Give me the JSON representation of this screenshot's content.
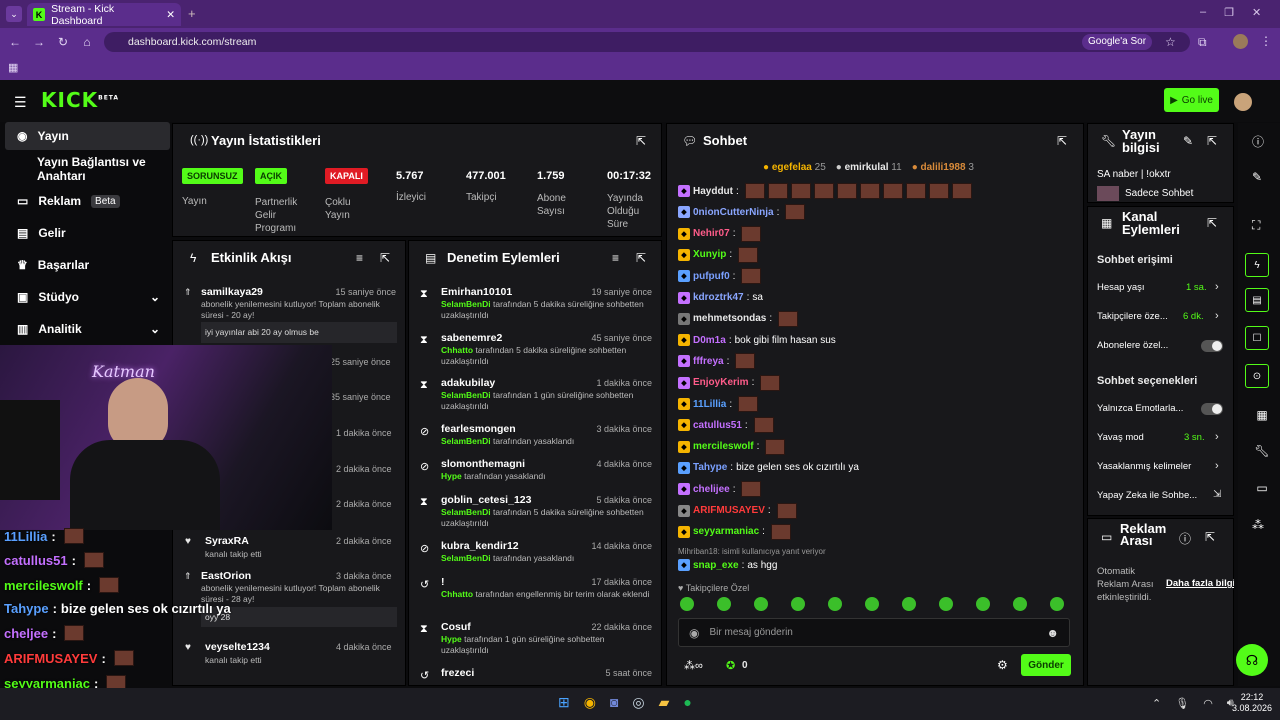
{
  "browser": {
    "tab_title": "Stream - Kick Dashboard",
    "url": "dashboard.kick.com/stream",
    "google_btn": "Google'a Sor"
  },
  "app": {
    "logo": "KICK",
    "logo_badge": "BETA",
    "go_live": "Go live"
  },
  "nav": [
    {
      "label": "Yayın"
    },
    {
      "label": "Yayın Bağlantısı ve Anahtarı"
    },
    {
      "label": "Reklam",
      "badge": "Beta"
    },
    {
      "label": "Gelir"
    },
    {
      "label": "Başarılar"
    },
    {
      "label": "Stüdyo"
    },
    {
      "label": "Analitik"
    }
  ],
  "stats": {
    "title": "Yayın İstatistikleri",
    "items": [
      {
        "badge": "SORUNSUZ",
        "label": "Yayın"
      },
      {
        "badge": "AÇIK",
        "label": "Partnerlik Gelir Programı"
      },
      {
        "badge": "KAPALI",
        "label": "Çoklu Yayın"
      },
      {
        "value": "5.767",
        "label": "İzleyici"
      },
      {
        "value": "477.001",
        "label": "Takipçi"
      },
      {
        "value": "1.759",
        "label": "Abone Sayısı"
      },
      {
        "value": "00:17:32",
        "label": "Yayında Olduğu Süre"
      }
    ]
  },
  "activity": {
    "title": "Etkinlik Akışı",
    "events": [
      {
        "name": "samilkaya29",
        "time": "15 saniye önce",
        "desc": "abonelik yenilemesini kutluyor! Toplam abonelik süresi - 20 ay!",
        "msg": "iyi yayınlar abi 20 ay olmus be"
      },
      {
        "time": "25 saniye önce"
      },
      {
        "time": "35 saniye önce"
      },
      {
        "time": "1 dakika önce"
      },
      {
        "time": "2 dakika önce"
      },
      {
        "time": "2 dakika önce"
      },
      {
        "name": "SyraxRA",
        "time": "2 dakika önce",
        "desc": "kanalı takip etti"
      },
      {
        "name": "EastOrion",
        "time": "3 dakika önce",
        "desc": "abonelik yenilemesini kutluyor! Toplam abonelik süresi - 28 ay!",
        "msg": "oyy 28"
      },
      {
        "name": "veyselte1234",
        "time": "4 dakika önce",
        "desc": "kanalı takip etti"
      }
    ]
  },
  "mod": {
    "title": "Denetim Eylemleri",
    "actions": [
      {
        "name": "Emirhan10101",
        "time": "19 saniye önce",
        "actor": "SelamBenDi",
        "desc": "tarafından 5 dakika süreliğine sohbetten uzaklaştırıldı"
      },
      {
        "name": "sabenemre2",
        "time": "45 saniye önce",
        "actor": "Chhatto",
        "desc": "tarafından 5 dakika süreliğine sohbetten uzaklaştırıldı"
      },
      {
        "name": "adakubilay",
        "time": "1 dakika önce",
        "actor": "SelamBenDi",
        "desc": "tarafından 1 gün süreliğine sohbetten uzaklaştırıldı"
      },
      {
        "name": "fearlesmongen",
        "time": "3 dakika önce",
        "actor": "SelamBenDi",
        "desc": "tarafından yasaklandı"
      },
      {
        "name": "slomonthemagni",
        "time": "4 dakika önce",
        "actor": "Hype",
        "desc": "tarafından yasaklandı"
      },
      {
        "name": "goblin_cetesi_123",
        "time": "5 dakika önce",
        "actor": "SelamBenDi",
        "desc": "tarafından 5 dakika süreliğine sohbetten uzaklaştırıldı"
      },
      {
        "name": "kubra_kendir12",
        "time": "14 dakika önce",
        "actor": "SelamBenDi",
        "desc": "tarafından yasaklandı"
      },
      {
        "name": "!",
        "time": "17 dakika önce",
        "actor": "Chhatto",
        "desc": "tarafından engellenmiş bir terim olarak eklendi"
      },
      {
        "name": "Cosuf",
        "time": "22 dakika önce",
        "actor": "Hype",
        "desc": "tarafından 1 gün süreliğine sohbetten uzaklaştırıldı"
      },
      {
        "name": "frezeci",
        "time": "5 saat önce"
      }
    ]
  },
  "chat": {
    "title": "Sohbet",
    "top": [
      {
        "name": "egefelaa",
        "n": "25"
      },
      {
        "name": "emirkulal",
        "n": "11"
      },
      {
        "name": "dalili1988",
        "n": "3"
      }
    ],
    "lines": [
      {
        "user": "Hayddut",
        "color": "#e8e8e8",
        "text": ""
      },
      {
        "user": "0nionCutterNinja",
        "color": "#8aa6ff",
        "text": ""
      },
      {
        "user": "Nehir07",
        "color": "#ff5c8a",
        "text": ""
      },
      {
        "user": "Xunyip",
        "color": "#53fc18",
        "text": ""
      },
      {
        "user": "pufpuf0",
        "color": "#7aa0ff",
        "text": ""
      },
      {
        "user": "kdroztrk47",
        "color": "#8aa6ff",
        "text": "sa"
      },
      {
        "user": "mehmetsondas",
        "color": "#e8e8e8",
        "text": ""
      },
      {
        "user": "D0m1a",
        "color": "#c470ff",
        "text": "bok gibi film hasan sus"
      },
      {
        "user": "fffreya",
        "color": "#c470ff",
        "text": ""
      },
      {
        "user": "EnjoyKerim",
        "color": "#ff5c8a",
        "text": ""
      },
      {
        "user": "11Lillia",
        "color": "#5aa0ff",
        "text": ""
      },
      {
        "user": "catullus51",
        "color": "#c470ff",
        "text": ""
      },
      {
        "user": "mercileswolf",
        "color": "#53fc18",
        "text": ""
      },
      {
        "user": "Tahype",
        "color": "#7aa0ff",
        "text": "bize gelen ses ok cızırtılı ya"
      },
      {
        "user": "chelijee",
        "color": "#c470ff",
        "text": ""
      },
      {
        "user": "ARIFMUSAYEV",
        "color": "#ff3b3b",
        "text": ""
      },
      {
        "user": "seyyarmaniac",
        "color": "#53fc18",
        "text": ""
      }
    ],
    "reply": "Mihriban18: isimli kullanıcıya yanıt veriyor",
    "last_user": "snap_exe",
    "last_text": "as hgg",
    "followers_label": "Takipçilere Özel",
    "input_placeholder": "Bir mesaj gönderin",
    "count": "0",
    "send": "Gönder"
  },
  "info": {
    "title": "Yayın bilgisi",
    "stream_title": "SA naber | !okxtr",
    "chat_mode": "Sadece Sohbet"
  },
  "channel": {
    "title": "Kanal Eylemleri",
    "access": "Sohbet erişimi",
    "rows": [
      {
        "label": "Hesap yaşı",
        "val": "1 sa."
      },
      {
        "label": "Takipçilere öze...",
        "val": "6 dk."
      },
      {
        "label": "Abonelere özel..."
      }
    ],
    "options": "Sohbet seçenekleri",
    "rows2": [
      {
        "label": "Yalnızca Emotlarla..."
      },
      {
        "label": "Yavaş mod",
        "val": "3 sn."
      },
      {
        "label": "Yasaklanmış kelimeler"
      },
      {
        "label": "Yapay Zeka ile Sohbe..."
      }
    ]
  },
  "ads": {
    "title": "Reklam Arası",
    "auto": "Otomatik Reklam Arası etkinleştirildi.",
    "more": "Daha fazla bilgi"
  },
  "overlay": [
    {
      "user": "11Lillia",
      "color": "#5aa0ff",
      "text": ""
    },
    {
      "user": "catullus51",
      "color": "#c470ff",
      "text": ""
    },
    {
      "user": "mercileswolf",
      "color": "#53fc18",
      "text": ""
    },
    {
      "user": "Tahype",
      "color": "#5aa0ff",
      "text": "bize gelen ses ok cızırtılı ya"
    },
    {
      "user": "cheljee",
      "color": "#c470ff",
      "text": ""
    },
    {
      "user": "ARIFMUSAYEV",
      "color": "#ff3b3b",
      "text": ""
    },
    {
      "user": "seyyarmaniac",
      "color": "#53fc18",
      "text": ""
    },
    {
      "user": "snap_exe",
      "color": "#53fc18",
      "text": "as hgg"
    }
  ],
  "cam": {
    "sign": "Katman"
  },
  "taskbar": {
    "time": "22:12",
    "date": "3.08.2026"
  }
}
